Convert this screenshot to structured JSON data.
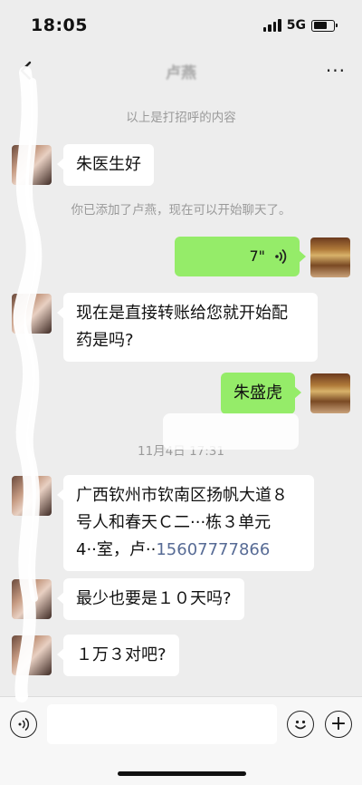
{
  "status_bar": {
    "time": "18:05",
    "network": "5G",
    "battery_level": 0.7
  },
  "nav": {
    "title": "卢燕",
    "back_icon": "chevron-left-icon",
    "more_label": "···"
  },
  "messages": {
    "greeting_note": "以上是打招呼的内容",
    "m1": "朱医生好",
    "added_note": "你已添加了卢燕，现在可以开始聊天了。",
    "voice_duration": "7\"",
    "m2_line1": "现在是直接转账给您就开始配",
    "m2_line2": "药是吗?",
    "m3": "朱盛虎",
    "timestamp": "11月4日 17:31",
    "m4_line1": "广西钦州市钦南区扬帆大道８",
    "m4_line2": "号人和春天Ｃ二···栋３单元",
    "m4_line3_prefix": "4··室，卢··",
    "m4_phone": "15607777866",
    "m5": "最少也要是１０天吗?",
    "m6": "１万３对吧?"
  },
  "input_bar": {
    "voice_icon": "voice-mode-icon",
    "emoji_icon": "emoji-icon",
    "plus_icon": "plus-icon",
    "plus_label": "+"
  },
  "colors": {
    "background": "#ededed",
    "incoming_bubble": "#ffffff",
    "outgoing_bubble": "#95ec69",
    "system_text": "#9a9a9a",
    "link": "#576b95"
  }
}
